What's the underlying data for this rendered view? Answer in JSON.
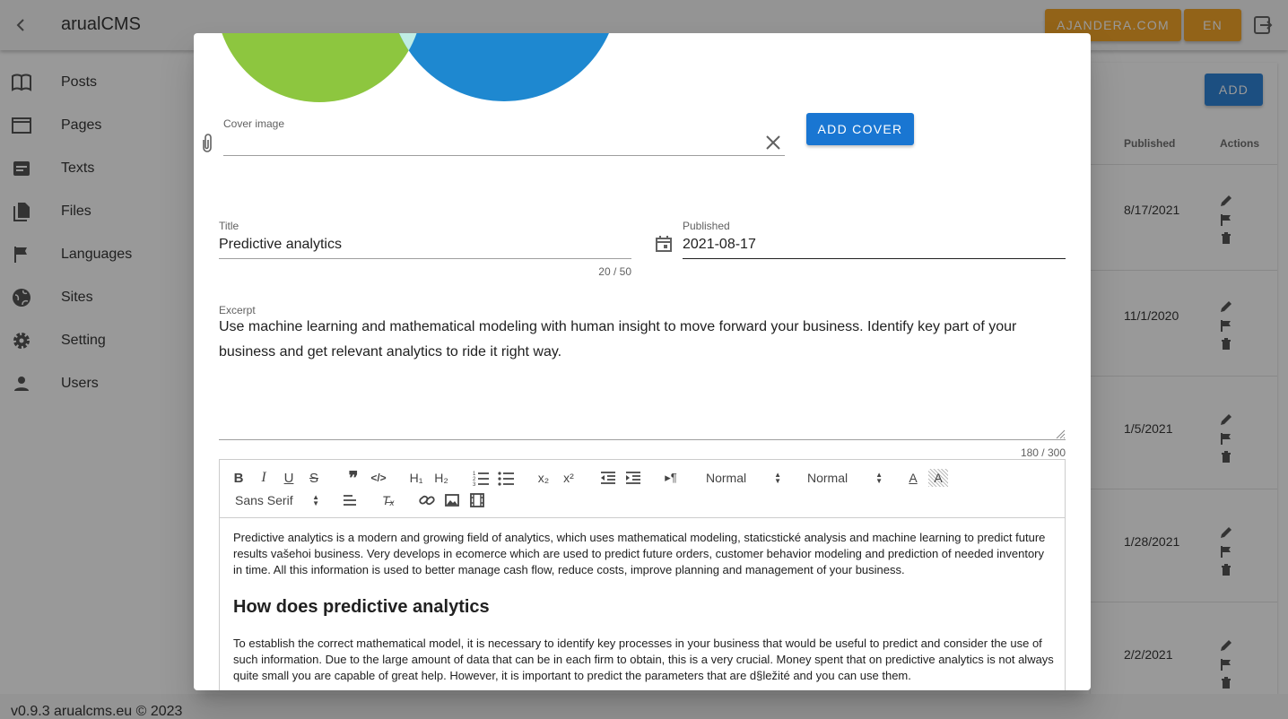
{
  "app": {
    "title": "arualCMS",
    "site_button": "AJANDERA.COM",
    "lang_button": "EN",
    "footer": "v0.9.3 arualcms.eu © 2023"
  },
  "sidebar": {
    "items": [
      {
        "label": "Posts",
        "icon": "book-open-icon"
      },
      {
        "label": "Pages",
        "icon": "window-icon"
      },
      {
        "label": "Texts",
        "icon": "text-box-icon"
      },
      {
        "label": "Files",
        "icon": "file-copy-icon"
      },
      {
        "label": "Languages",
        "icon": "flag-icon"
      },
      {
        "label": "Sites",
        "icon": "globe-icon"
      },
      {
        "label": "Setting",
        "icon": "gear-icon"
      },
      {
        "label": "Users",
        "icon": "person-icon"
      }
    ]
  },
  "list": {
    "add_button": "ADD",
    "headers": {
      "published": "Published",
      "actions": "Actions"
    },
    "rows": [
      {
        "published": "8/17/2021"
      },
      {
        "published": "11/1/2020"
      },
      {
        "published": "1/5/2021"
      },
      {
        "published": "1/28/2021"
      },
      {
        "published": "2/2/2021"
      }
    ]
  },
  "dialog": {
    "cover": {
      "label": "Cover image",
      "value": "",
      "add_button": "ADD COVER"
    },
    "title": {
      "label": "Title",
      "value": "Predictive analytics",
      "counter": "20 / 50"
    },
    "published": {
      "label": "Published",
      "value": "2021-08-17"
    },
    "excerpt": {
      "label": "Excerpt",
      "value": "Use machine learning and mathematical modeling with human insight to move forward your business. Identify key part of your business and get relevant analytics to ride it right way.",
      "counter": "180 / 300"
    },
    "toolbar": {
      "header_select": "Normal",
      "size_select": "Normal",
      "font_select": "Sans Serif"
    },
    "content": {
      "p1": "Predictive analytics is a modern and growing field of analytics, which uses mathematical modeling, staticstické analysis and machine learning to predict future results vašehoi business. Very develops in ecomerce which are used to predict future orders, customer behavior modeling and prediction of needed inventory in time. All this information is used to better manage cash flow, reduce costs, improve planning and management of your business.",
      "h2": "How does predictive analytics",
      "p2": "To establish the correct mathematical model, it is necessary to identify key processes in your business that would be useful to predict and consider the use of such information. Due to the large amount of data that can be in each firm to obtain, this is a very crucial. Money spent that on predictive analytics is not always quite small you are capable of great help. However, it is important to predict the parameters that are d§ležité and you can use them."
    }
  },
  "colors": {
    "primary": "#1976d2",
    "accent": "#f39c12",
    "green": "#8dc63f",
    "blue": "#1e88d0"
  }
}
